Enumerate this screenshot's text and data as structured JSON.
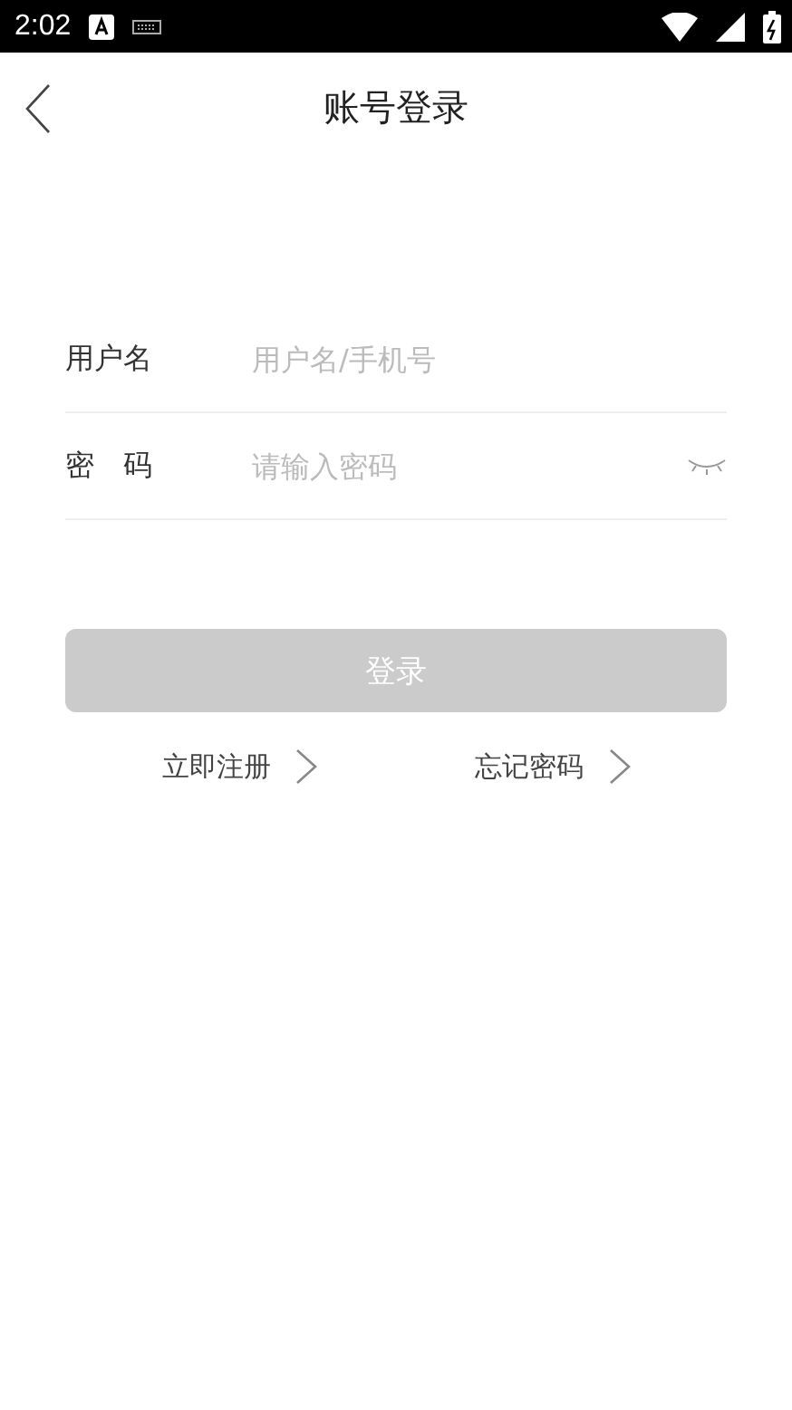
{
  "status_bar": {
    "time": "2:02"
  },
  "header": {
    "title": "账号登录"
  },
  "fields": [
    {
      "kind": "text",
      "label": "用户名",
      "placeholder": "用户名/手机号"
    },
    {
      "kind": "password",
      "label": "密　码",
      "placeholder": "请输入密码"
    }
  ],
  "login_button": {
    "label": "登录",
    "disabled": true
  },
  "links": [
    {
      "label": "立即注册"
    },
    {
      "label": "忘记密码"
    }
  ]
}
